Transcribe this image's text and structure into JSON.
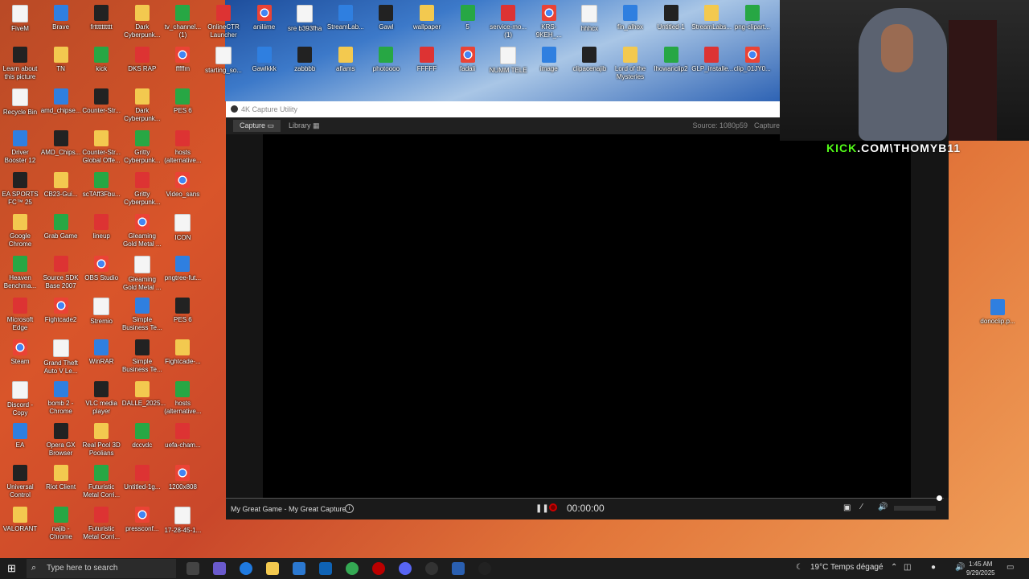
{
  "desktop": {
    "top_row": [
      "FiveM",
      "Brave",
      "frtttttttttt",
      "Dark Cyberpunk...",
      "tv_channel... (1)",
      "OnlineCTR Launcher",
      "aniliime",
      "sre b393fha",
      "StreamLab...",
      "Gawl",
      "wallpaper",
      "5",
      "service-mo... (1)",
      "KRS-9KEH_...",
      "hhhcx",
      "fin_alhox",
      "Untitled-1",
      "StreamLabs...",
      "png-clipart..."
    ],
    "second_row": [
      "Learn about this picture",
      "TN",
      "kick",
      "DKS RAP",
      "fffffm",
      "starting_so...",
      "Gawlkkk",
      "zabbbb",
      "afiams",
      "photoooo",
      "FFFFF",
      "fadali",
      "NUMM TELE",
      "image",
      "clipacenajib",
      "Lord of the Mysteries",
      "lhowariclip2",
      "GLP_installe...",
      "clip_01JY0..."
    ],
    "left_cols": [
      [
        "Recycle Bin",
        "Driver Booster 12",
        "EA SPORTS FC™ 25",
        "Google Chrome",
        "Heaven Benchma...",
        "Microsoft Edge",
        "Steam",
        "Discord - Copy",
        "EA",
        "Universal Control",
        "VALORANT"
      ],
      [
        "amd_chipse...",
        "AMD_Chips...",
        "CB23-Gui...",
        "Grab Game",
        "Source SDK Base 2007",
        "Fightcade2",
        "Grand Theft Auto V Le...",
        "bomb 2 - Chrome",
        "Opera GX Browser",
        "Riot Client",
        "najib - Chrome"
      ],
      [
        "Counter-Str...",
        "Counter-Str... Global Offe...",
        "scTAff3Fbu...",
        "lineup",
        "OBS Studio",
        "Stremio",
        "WinRAR",
        "VLC media player",
        "Real Pool 3D Poolians",
        "Futuristic Metal Corri...",
        "Futuristic Metal Corri..."
      ],
      [
        "Dark Cyberpunk...",
        "Gritty Cyberpunk...",
        "Gritty Cyberpunk...",
        "Gleaming Gold Metal ...",
        "Gleaming Gold Metal ...",
        "Simple Business Te...",
        "Simple Business Te...",
        "DALLE_2025...",
        "dccvdc",
        "Untitled-1g...",
        "pressconf..."
      ],
      [
        "PES 6",
        "hosts (alternative...",
        "Video_sans",
        "ICON",
        "pngtree-fut...",
        "PES 6",
        "Fightcade-...",
        "hosts (alternative...",
        "uefa-cham...",
        "1200x808",
        "17-28-45-1..."
      ]
    ],
    "right_icon": "donoclip.p..."
  },
  "capture_window": {
    "title": "4K Capture Utility",
    "tabs": [
      "Capture",
      "Library"
    ],
    "source": "Source: 1080p59",
    "capture_label": "Capture",
    "game_title": "My Great Game - My Great Capture",
    "timer": "00:00:00"
  },
  "webcam": {
    "banner_brand": "KICK",
    "banner_handle": ".COM\\THOMYB11"
  },
  "taskbar": {
    "search_placeholder": "Type here to search",
    "weather": "19°C  Temps dégagé",
    "time": "1:45 AM",
    "date": "9/29/2025"
  }
}
